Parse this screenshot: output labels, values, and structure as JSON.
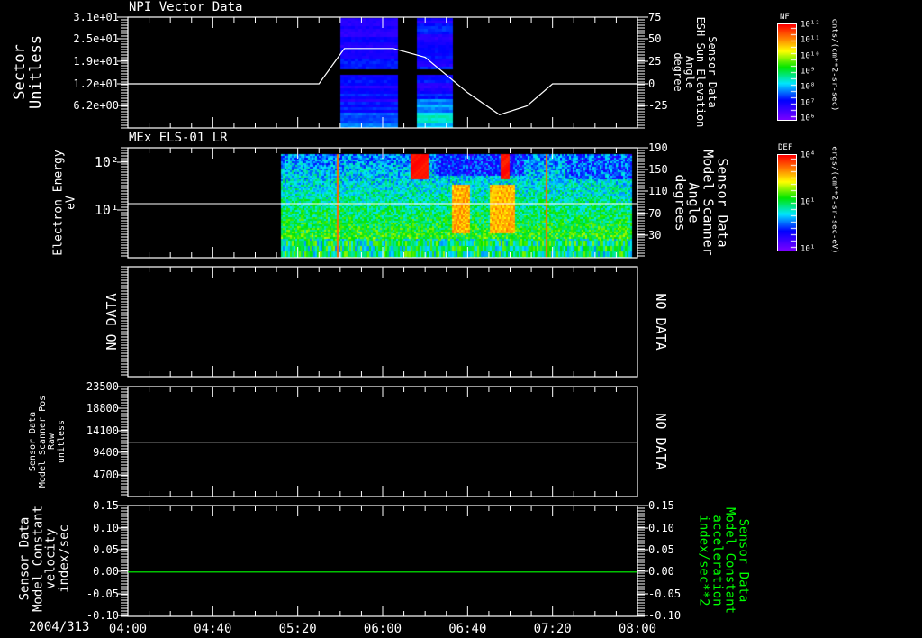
{
  "colors": {
    "background": "#000000",
    "axes": "#ffffff",
    "green_series": "#00ff00"
  },
  "date_label": "2004/313",
  "time_ticks": [
    "04:00",
    "04:40",
    "05:20",
    "06:00",
    "06:40",
    "07:20",
    "08:00"
  ],
  "chart_data": [
    {
      "type": "line",
      "title": "NPI Vector Data",
      "ylabel_left": [
        "Sector",
        "Unitless"
      ],
      "yticks_left": [
        "3.1e+01",
        "2.5e+01",
        "1.9e+01",
        "1.2e+01",
        "6.2e+00"
      ],
      "ylabel_right": [
        "Sensor Data",
        "ESH Sun Elevation",
        "Angle",
        "degree"
      ],
      "yticks_right": [
        "75",
        "50",
        "25",
        "0",
        "-25"
      ],
      "ylim_right": [
        -50,
        75
      ],
      "series": [
        {
          "x": [
            "04:00",
            "05:30",
            "05:36",
            "05:42",
            "06:05",
            "06:20",
            "06:40",
            "06:55",
            "07:08",
            "07:20",
            "08:00"
          ],
          "values": [
            0,
            0,
            20,
            40,
            40,
            30,
            -10,
            -35,
            -25,
            0,
            0
          ]
        }
      ],
      "heatmap": {
        "colorbar_label": "NF",
        "colorbar_units": "cnts/(cm**2-sr-sec)",
        "colorbar_ticks": [
          "10¹²",
          "10¹¹",
          "10¹⁰",
          "10⁹",
          "10⁸",
          "10⁷",
          "10⁶"
        ],
        "blocks": [
          [
            "05:40",
            "06:07"
          ],
          [
            "06:16",
            "06:33"
          ]
        ]
      }
    },
    {
      "type": "heatmap",
      "title": "MEx ELS-01 LR",
      "ylabel_left": [
        "Electron Energy",
        "eV"
      ],
      "yticks_left": [
        "10²",
        "10¹"
      ],
      "ylabel_right": [
        "Sensor Data",
        "Model Scanner",
        "Angle",
        "degrees"
      ],
      "yticks_right": [
        "190",
        "150",
        "110",
        "70",
        "30"
      ],
      "series": [
        {
          "x": [
            "04:00",
            "08:00"
          ],
          "values": [
            80,
            80
          ]
        }
      ],
      "colorbar_label": "DEF",
      "colorbar_units": "ergs/(cm**2-sr-sec-eV)",
      "colorbar_ticks": [
        "10⁴",
        "10¹",
        "10¹"
      ],
      "data_range": [
        "05:12",
        "07:57"
      ]
    },
    {
      "type": "line",
      "left_text": "NO DATA",
      "right_text": "NO DATA"
    },
    {
      "type": "line",
      "ylabel_left": [
        "Sensor Data",
        "Model Scanner Pos",
        "Raw",
        "unitless"
      ],
      "yticks_left": [
        "23500",
        "18800",
        "14100",
        "9400",
        "4700"
      ],
      "ylim": [
        0,
        23500
      ],
      "series": [
        {
          "x": [
            "04:00",
            "08:00"
          ],
          "values": [
            11600,
            11600
          ]
        }
      ],
      "right_text": "NO DATA"
    },
    {
      "type": "line",
      "ylabel_left": [
        "Sensor Data",
        "Model Constant",
        "velocity",
        "index/sec"
      ],
      "yticks_left": [
        "0.15",
        "0.10",
        "0.05",
        "0.00",
        "-0.05",
        "-0.10"
      ],
      "ylabel_right": [
        "Sensor Data",
        "Model Constant",
        "acceleration",
        "index/sec**2"
      ],
      "yticks_right": [
        "0.15",
        "0.10",
        "0.05",
        "0.00",
        "-0.05",
        "-0.10"
      ],
      "ylim": [
        -0.1,
        0.15
      ],
      "series": [
        {
          "x": [
            "04:00",
            "08:00"
          ],
          "values": [
            0,
            0
          ]
        }
      ]
    }
  ]
}
